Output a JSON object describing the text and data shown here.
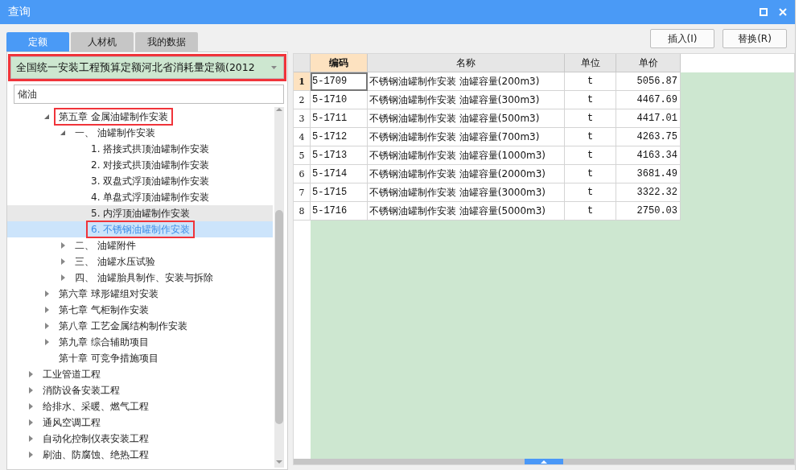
{
  "window": {
    "title": "查询"
  },
  "tabs": [
    {
      "label": "定额",
      "selected": true
    },
    {
      "label": "人材机",
      "selected": false
    },
    {
      "label": "我的数据",
      "selected": false
    }
  ],
  "library_select": {
    "value": "全国统一安装工程预算定额河北省消耗量定额(2012",
    "highlighted": true
  },
  "search": {
    "value": "储油"
  },
  "tree": {
    "scrolled_children": [
      {
        "label": "第五章 金属油罐制作安装",
        "kind": "branch",
        "expanded": true,
        "highlighted": true,
        "children": [
          {
            "label": "一、 油罐制作安装",
            "kind": "branch",
            "expanded": true,
            "children": [
              {
                "label": "1. 搭接式拱顶油罐制作安装",
                "kind": "leaf",
                "selected": false,
                "hovered": false
              },
              {
                "label": "2. 对接式拱顶油罐制作安装",
                "kind": "leaf",
                "selected": false,
                "hovered": false
              },
              {
                "label": "3. 双盘式浮顶油罐制作安装",
                "kind": "leaf",
                "selected": false,
                "hovered": false
              },
              {
                "label": "4. 单盘式浮顶油罐制作安装",
                "kind": "leaf",
                "selected": false,
                "hovered": false
              },
              {
                "label": "5. 内浮顶油罐制作安装",
                "kind": "leaf",
                "selected": false,
                "hovered": true
              },
              {
                "label": "6. 不锈钢油罐制作安装",
                "kind": "leaf",
                "selected": true,
                "hovered": false,
                "highlighted": true
              }
            ]
          },
          {
            "label": "二、 油罐附件",
            "kind": "branch",
            "expanded": false
          },
          {
            "label": "三、 油罐水压试验",
            "kind": "branch",
            "expanded": false
          },
          {
            "label": "四、 油罐胎具制作、安装与拆除",
            "kind": "branch",
            "expanded": false
          }
        ]
      },
      {
        "label": "第六章 球形罐组对安装",
        "kind": "branch",
        "expanded": false
      },
      {
        "label": "第七章 气柜制作安装",
        "kind": "branch",
        "expanded": false
      },
      {
        "label": "第八章 工艺金属结构制作安装",
        "kind": "branch",
        "expanded": false
      },
      {
        "label": "第九章 综合辅助项目",
        "kind": "branch",
        "expanded": false
      },
      {
        "label": "第十章 可竞争措施项目",
        "kind": "leaf"
      }
    ],
    "items": [
      {
        "label": "工业管道工程",
        "kind": "branch",
        "expanded": false
      },
      {
        "label": "消防设备安装工程",
        "kind": "branch",
        "expanded": false
      },
      {
        "label": "给排水、采暖、燃气工程",
        "kind": "branch",
        "expanded": false
      },
      {
        "label": "通风空调工程",
        "kind": "branch",
        "expanded": false
      },
      {
        "label": "自动化控制仪表安装工程",
        "kind": "branch",
        "expanded": false
      },
      {
        "label": "刷油、防腐蚀、绝热工程",
        "kind": "branch",
        "expanded": false
      }
    ]
  },
  "buttons": [
    "插入(I)",
    "替换(R)"
  ],
  "table": {
    "columns": [
      {
        "label": "编码",
        "selected": true
      },
      {
        "label": "名称",
        "selected": false
      },
      {
        "label": "单位",
        "selected": false
      },
      {
        "label": "单价",
        "selected": false
      }
    ],
    "rows": [
      {
        "number": "1",
        "selected": true,
        "cells": [
          "5-1709",
          "不锈钢油罐制作安装 油罐容量(200m3)",
          "t",
          "5056.87"
        ]
      },
      {
        "number": "2",
        "selected": false,
        "cells": [
          "5-1710",
          "不锈钢油罐制作安装 油罐容量(300m3)",
          "t",
          "4467.69"
        ]
      },
      {
        "number": "3",
        "selected": false,
        "cells": [
          "5-1711",
          "不锈钢油罐制作安装 油罐容量(500m3)",
          "t",
          "4417.01"
        ]
      },
      {
        "number": "4",
        "selected": false,
        "cells": [
          "5-1712",
          "不锈钢油罐制作安装 油罐容量(700m3)",
          "t",
          "4263.75"
        ]
      },
      {
        "number": "5",
        "selected": false,
        "cells": [
          "5-1713",
          "不锈钢油罐制作安装 油罐容量(1000m3)",
          "t",
          "4163.34"
        ]
      },
      {
        "number": "6",
        "selected": false,
        "cells": [
          "5-1714",
          "不锈钢油罐制作安装 油罐容量(2000m3)",
          "t",
          "3681.49"
        ]
      },
      {
        "number": "7",
        "selected": false,
        "cells": [
          "5-1715",
          "不锈钢油罐制作安装 油罐容量(3000m3)",
          "t",
          "3322.32"
        ]
      },
      {
        "number": "8",
        "selected": false,
        "cells": [
          "5-1716",
          "不锈钢油罐制作安装 油罐容量(5000m3)",
          "t",
          "2750.03"
        ]
      }
    ]
  }
}
